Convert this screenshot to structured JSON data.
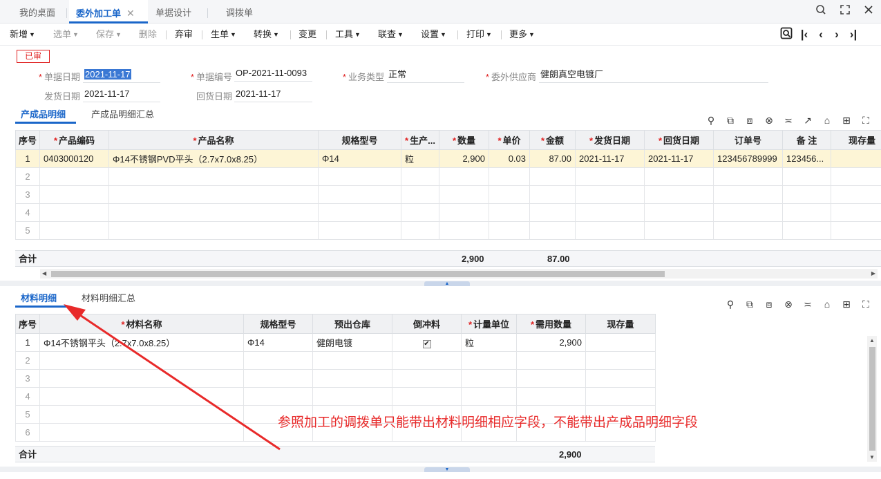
{
  "tabs": [
    {
      "label": "我的桌面",
      "active": false
    },
    {
      "label": "委外加工单",
      "active": true
    },
    {
      "label": "单据设计",
      "active": false
    },
    {
      "label": "调拨单",
      "active": false
    }
  ],
  "window_icons": [
    "search-icon",
    "fullscreen-icon",
    "close-icon"
  ],
  "toolbar": {
    "items": [
      {
        "label": "新增",
        "dropdown": true,
        "disabled": false
      },
      {
        "label": "选单",
        "dropdown": true,
        "disabled": true
      },
      {
        "label": "保存",
        "dropdown": true,
        "disabled": true
      },
      {
        "label": "删除",
        "dropdown": false,
        "disabled": true
      },
      {
        "label": "弃审",
        "dropdown": false,
        "disabled": false
      },
      {
        "label": "生单",
        "dropdown": true,
        "disabled": false
      },
      {
        "label": "转换",
        "dropdown": true,
        "disabled": false
      },
      {
        "label": "变更",
        "dropdown": false,
        "disabled": false
      },
      {
        "label": "工具",
        "dropdown": true,
        "disabled": false
      },
      {
        "label": "联查",
        "dropdown": true,
        "disabled": false
      },
      {
        "label": "设置",
        "dropdown": true,
        "disabled": false
      },
      {
        "label": "打印",
        "dropdown": true,
        "disabled": false
      },
      {
        "label": "更多",
        "dropdown": true,
        "disabled": false
      }
    ],
    "nav_icons": [
      "locate-icon",
      "first-icon",
      "prev-icon",
      "next-icon",
      "last-icon"
    ]
  },
  "status": "已审",
  "form": {
    "doc_date": {
      "label": "单据日期",
      "value": "2021-11-17",
      "required": true
    },
    "doc_no": {
      "label": "单据编号",
      "value": "OP-2021-11-0093",
      "required": true
    },
    "biz_type": {
      "label": "业务类型",
      "value": "正常",
      "required": true
    },
    "supplier": {
      "label": "委外供应商",
      "value": "健朗真空电镀厂",
      "required": true
    },
    "ship_date": {
      "label": "发货日期",
      "value": "2021-11-17",
      "required": false
    },
    "return_date": {
      "label": "回货日期",
      "value": "2021-11-17",
      "required": false
    }
  },
  "product_section": {
    "tabs": [
      "产成品明细",
      "产成品明细汇总"
    ],
    "columns": [
      {
        "label": "序号",
        "required": false
      },
      {
        "label": "产品编码",
        "required": true
      },
      {
        "label": "产品名称",
        "required": true
      },
      {
        "label": "规格型号",
        "required": false
      },
      {
        "label": "生产...",
        "required": true
      },
      {
        "label": "数量",
        "required": true
      },
      {
        "label": "单价",
        "required": true
      },
      {
        "label": "金额",
        "required": true
      },
      {
        "label": "发货日期",
        "required": true
      },
      {
        "label": "回货日期",
        "required": true
      },
      {
        "label": "订单号",
        "required": false
      },
      {
        "label": "备 注",
        "required": false
      },
      {
        "label": "现存量",
        "required": false
      }
    ],
    "rows": [
      [
        "1",
        "0403000120",
        "Φ14不锈钢PVD平头（2.7x7.0x8.25）",
        "Φ14",
        "粒",
        "2,900",
        "0.03",
        "87.00",
        "2021-11-17",
        "2021-11-17",
        "123456789999",
        "123456...",
        ""
      ],
      [
        "2",
        "",
        "",
        "",
        "",
        "",
        "",
        "",
        "",
        "",
        "",
        "",
        ""
      ],
      [
        "3",
        "",
        "",
        "",
        "",
        "",
        "",
        "",
        "",
        "",
        "",
        "",
        ""
      ],
      [
        "4",
        "",
        "",
        "",
        "",
        "",
        "",
        "",
        "",
        "",
        "",
        "",
        ""
      ],
      [
        "5",
        "",
        "",
        "",
        "",
        "",
        "",
        "",
        "",
        "",
        "",
        "",
        ""
      ]
    ],
    "total": {
      "label": "合计",
      "qty": "2,900",
      "amount": "87.00"
    }
  },
  "material_section": {
    "tabs": [
      "材料明细",
      "材料明细汇总"
    ],
    "columns": [
      {
        "label": "序号",
        "required": false
      },
      {
        "label": "材料名称",
        "required": true
      },
      {
        "label": "规格型号",
        "required": false
      },
      {
        "label": "预出仓库",
        "required": false
      },
      {
        "label": "倒冲料",
        "required": false
      },
      {
        "label": "计量单位",
        "required": true
      },
      {
        "label": "需用数量",
        "required": true
      },
      {
        "label": "现存量",
        "required": false
      }
    ],
    "rows": [
      [
        "1",
        "Φ14不锈钢平头（2.7x7.0x8.25）",
        "Φ14",
        "健朗电镀",
        "checked",
        "粒",
        "2,900",
        ""
      ],
      [
        "2",
        "",
        "",
        "",
        "",
        "",
        "",
        ""
      ],
      [
        "3",
        "",
        "",
        "",
        "",
        "",
        "",
        ""
      ],
      [
        "4",
        "",
        "",
        "",
        "",
        "",
        "",
        ""
      ],
      [
        "5",
        "",
        "",
        "",
        "",
        "",
        "",
        ""
      ],
      [
        "6",
        "",
        "",
        "",
        "",
        "",
        "",
        ""
      ]
    ],
    "total": {
      "label": "合计",
      "qty": "2,900"
    }
  },
  "annotation": "参照加工的调拨单只能带出材料明细相应字段，不能带出产成品明细字段",
  "colors": {
    "accent": "#1a66c9",
    "required": "#e02020",
    "highlight_row": "#fdf5d6",
    "annotation": "#e82a2a"
  }
}
